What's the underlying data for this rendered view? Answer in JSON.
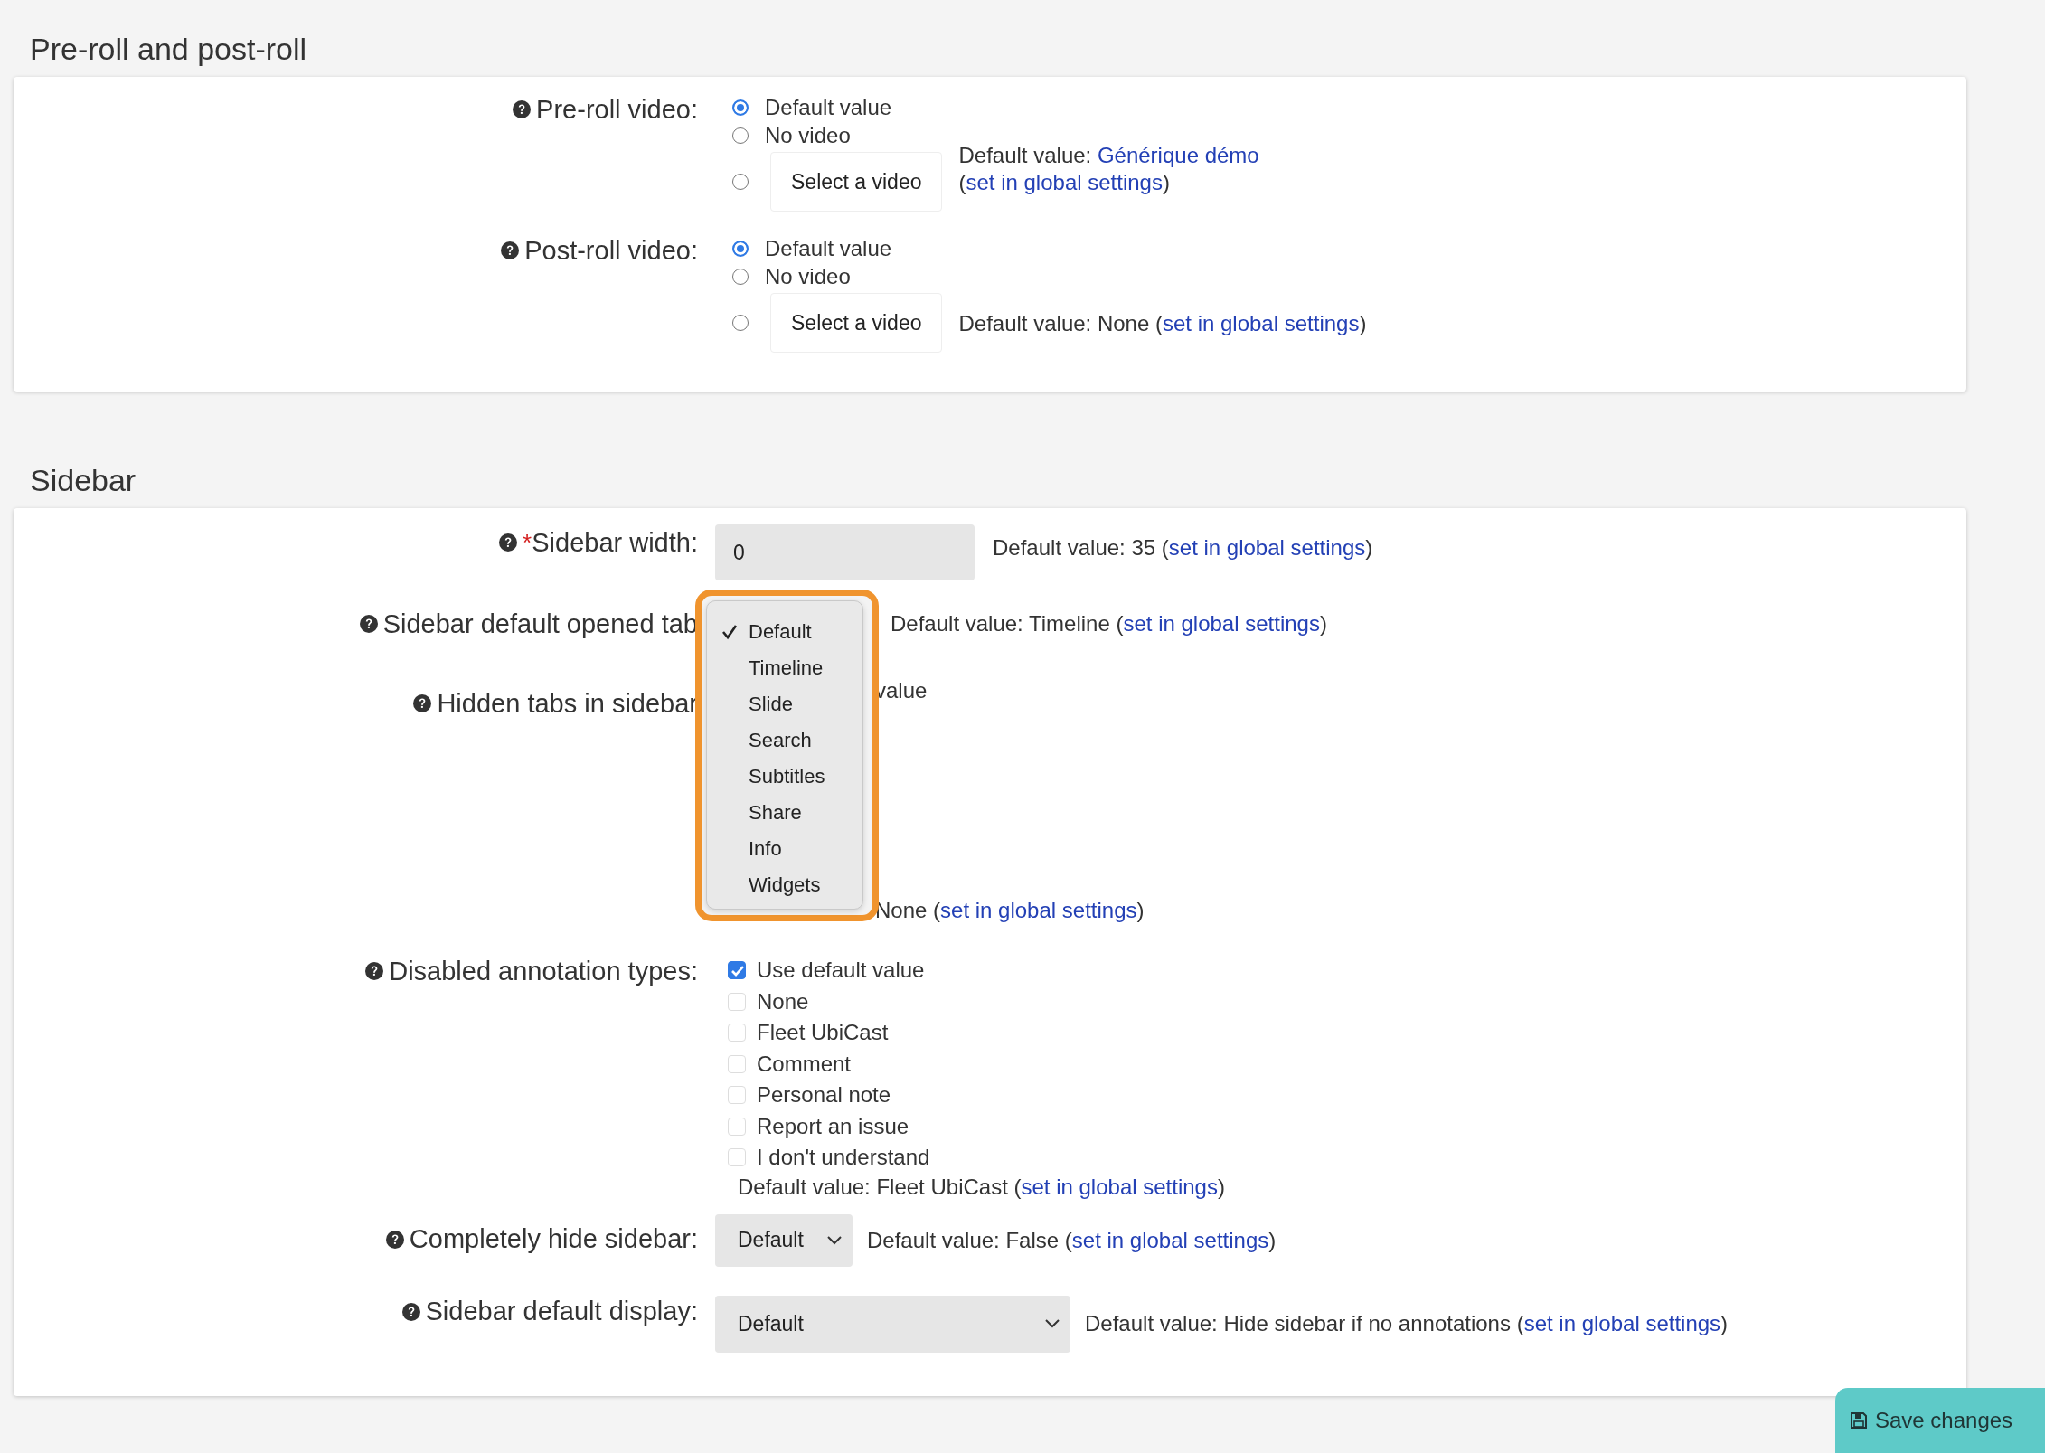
{
  "sections": [
    {
      "title": "Pre-roll and post-roll",
      "fields": [
        {
          "kind": "video",
          "label": "Pre-roll video:",
          "options": [
            {
              "label": "Default value",
              "selected": true
            },
            {
              "label": "No video",
              "selected": false
            },
            {
              "button": "Select a video",
              "selected": false
            }
          ],
          "note_lines": [
            [
              {
                "text": "Default value: "
              },
              {
                "link": "Générique démo"
              }
            ],
            [
              {
                "text": "("
              },
              {
                "link": "set in global settings"
              },
              {
                "text": ")"
              }
            ]
          ]
        },
        {
          "kind": "video",
          "label": "Post-roll video:",
          "options": [
            {
              "label": "Default value",
              "selected": true
            },
            {
              "label": "No video",
              "selected": false
            },
            {
              "button": "Select a video",
              "selected": false
            }
          ],
          "note": [
            {
              "text": "Default value: None ("
            },
            {
              "link": "set in global settings"
            },
            {
              "text": ")"
            }
          ]
        }
      ]
    },
    {
      "title": "Sidebar",
      "fields": [
        {
          "kind": "input",
          "label": "Sidebar width:",
          "required_mark": "*",
          "value": "0",
          "note": [
            {
              "text": "Default value: 35 ("
            },
            {
              "link": "set in global settings"
            },
            {
              "text": ")"
            }
          ]
        },
        {
          "kind": "menu",
          "label": "Sidebar default opened tab",
          "menu": [
            {
              "label": "Default",
              "selected": true
            },
            {
              "label": "Timeline",
              "selected": false
            },
            {
              "label": "Slide",
              "selected": false
            },
            {
              "label": "Search",
              "selected": false
            },
            {
              "label": "Subtitles",
              "selected": false
            },
            {
              "label": "Share",
              "selected": false
            },
            {
              "label": "Info",
              "selected": false
            },
            {
              "label": "Widgets",
              "selected": false
            }
          ],
          "note": [
            {
              "text": "Default value: Timeline ("
            },
            {
              "link": "set in global settings"
            },
            {
              "text": ")"
            }
          ]
        },
        {
          "kind": "covered",
          "label": "Hidden tabs in sidebar",
          "fragment": "value",
          "note": [
            {
              "text": "None ("
            },
            {
              "link": "set in global settings"
            },
            {
              "text": ")"
            }
          ]
        },
        {
          "kind": "checkboxes",
          "label": "Disabled annotation types:",
          "options": [
            {
              "label": "Use default value",
              "checked": true
            },
            {
              "label": "None",
              "checked": false
            },
            {
              "label": "Fleet UbiCast",
              "checked": false
            },
            {
              "label": "Comment",
              "checked": false
            },
            {
              "label": "Personal note",
              "checked": false
            },
            {
              "label": "Report an issue",
              "checked": false
            },
            {
              "label": "I don't understand",
              "checked": false
            }
          ],
          "note": [
            {
              "text": "Default value: Fleet UbiCast ("
            },
            {
              "link": "set in global settings"
            },
            {
              "text": ")"
            }
          ]
        },
        {
          "kind": "select",
          "label": "Completely hide sidebar:",
          "value": "Default",
          "note": [
            {
              "text": "Default value: False ("
            },
            {
              "link": "set in global settings"
            },
            {
              "text": ")"
            }
          ]
        },
        {
          "kind": "wideselect",
          "label": "Sidebar default display:",
          "value": "Default",
          "note": [
            {
              "text": "Default value: Hide sidebar if no annotations ("
            },
            {
              "link": "set in global settings"
            },
            {
              "text": ")"
            }
          ]
        }
      ]
    }
  ],
  "save_button": {
    "label": "Save changes"
  }
}
